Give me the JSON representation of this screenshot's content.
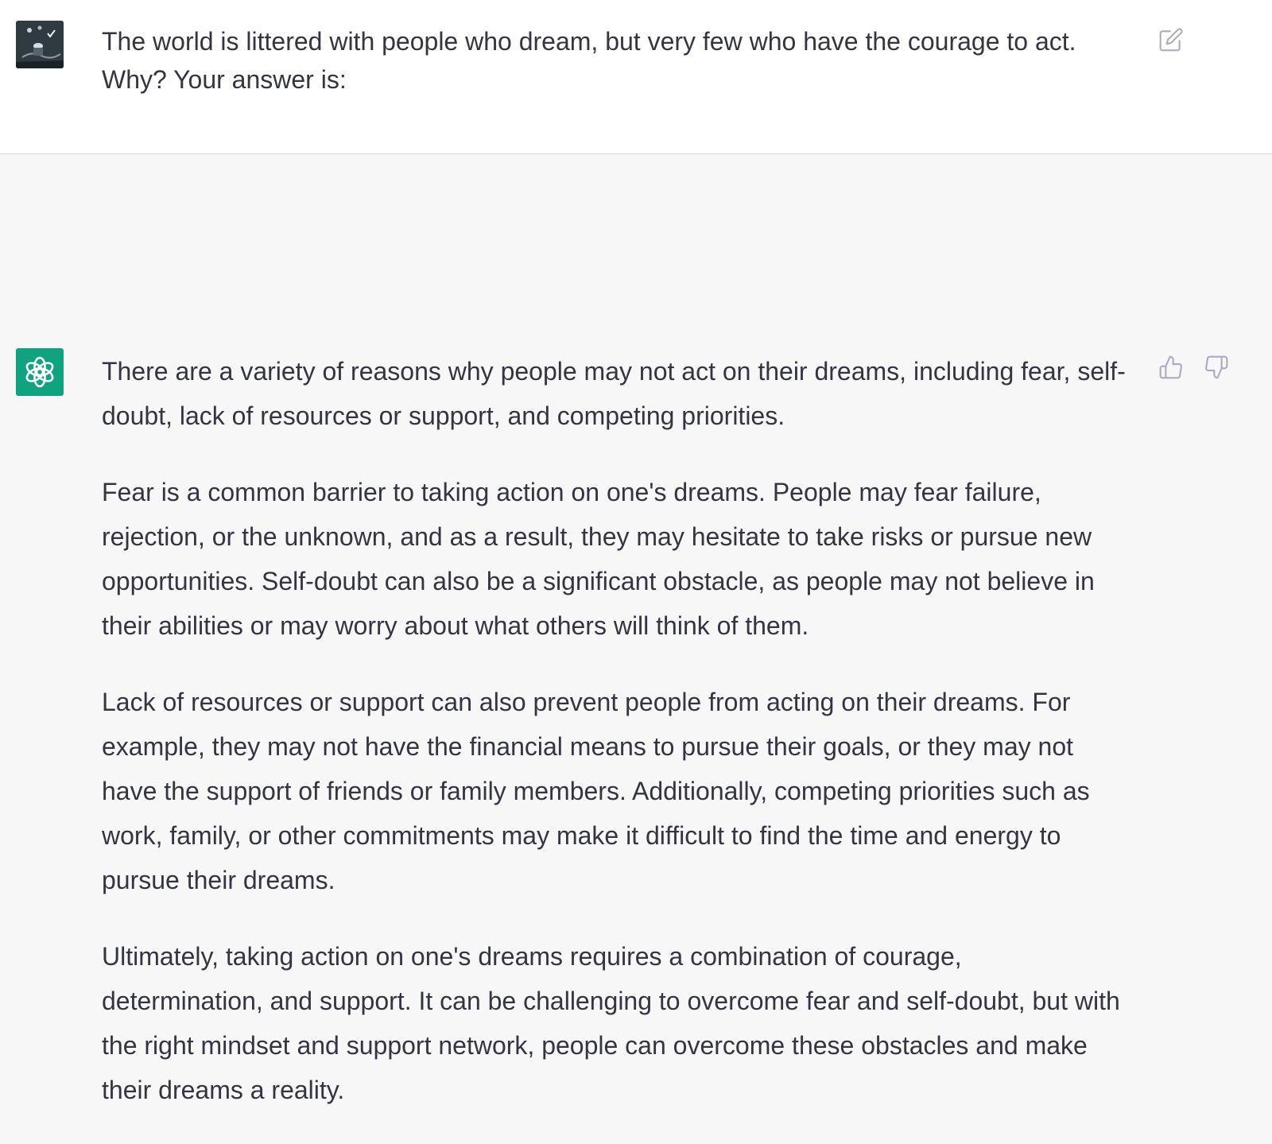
{
  "conversation": {
    "user_message": {
      "avatar_icon": "user-avatar-photo",
      "text": "The world is littered with people who dream, but very few who have the courage to act. Why? Your answer is:",
      "edit_icon": "edit-icon"
    },
    "assistant_message": {
      "avatar_icon": "openai-logo-icon",
      "avatar_color": "#10a37f",
      "paragraphs": [
        "There are a variety of reasons why people may not act on their dreams, including fear, self-doubt, lack of resources or support, and competing priorities.",
        "Fear is a common barrier to taking action on one's dreams. People may fear failure, rejection, or the unknown, and as a result, they may hesitate to take risks or pursue new opportunities. Self-doubt can also be a significant obstacle, as people may not believe in their abilities or may worry about what others will think of them.",
        "Lack of resources or support can also prevent people from acting on their dreams. For example, they may not have the financial means to pursue their goals, or they may not have the support of friends or family members. Additionally, competing priorities such as work, family, or other commitments may make it difficult to find the time and energy to pursue their dreams.",
        "Ultimately, taking action on one's dreams requires a combination of courage, determination, and support. It can be challenging to overcome fear and self-doubt, but with the right mindset and support network, people can overcome these obstacles and make their dreams a reality."
      ],
      "feedback_icons": [
        "thumbs-up-icon",
        "thumbs-down-icon"
      ]
    }
  },
  "colors": {
    "text": "#343541",
    "user_bg": "#ffffff",
    "assistant_bg": "#f7f7f8",
    "icon": "#acacbe"
  }
}
